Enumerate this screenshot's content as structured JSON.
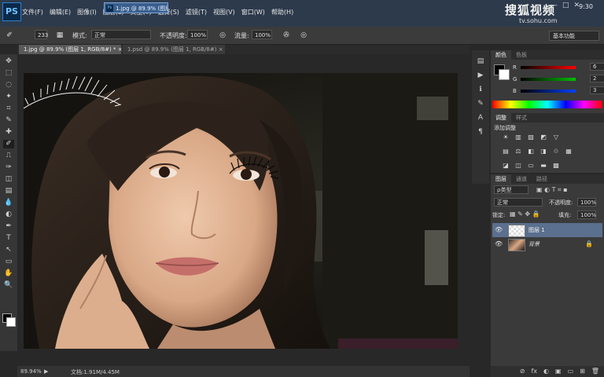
{
  "app": {
    "logo": "PS",
    "taskbar_title": "1.jpg @ 89.9% (图层..."
  },
  "menu": [
    "文件(F)",
    "编辑(E)",
    "图像(I)",
    "图层(L)",
    "类型(Y)",
    "选择(S)",
    "滤镜(T)",
    "视图(V)",
    "窗口(W)",
    "帮助(H)"
  ],
  "window_controls": {
    "minimize": "—",
    "maximize": "□",
    "close": "✕"
  },
  "watermark": {
    "logo": "搜狐视频",
    "url": "tv.sohu.com"
  },
  "clock": "9:30",
  "options": {
    "brush_size": "233",
    "mode_label": "模式:",
    "mode_value": "正常",
    "opacity_label": "不透明度:",
    "opacity_value": "100%",
    "flow_label": "流量:",
    "flow_value": "100%",
    "workspace": "基本功能"
  },
  "tabs": [
    {
      "label": "1.jpg @ 89.9% (图层 1, RGB/8#) * ×",
      "active": true
    },
    {
      "label": "1.psd @ 89.9% (图层 1, RGB/8#) ×",
      "active": false
    }
  ],
  "tools": [
    "move-icon",
    "marquee-icon",
    "lasso-icon",
    "magic-wand-icon",
    "crop-icon",
    "eyedropper-icon",
    "healing-icon",
    "brush-icon",
    "stamp-icon",
    "history-brush-icon",
    "eraser-icon",
    "gradient-icon",
    "blur-icon",
    "dodge-icon",
    "pen-icon",
    "type-icon",
    "path-select-icon",
    "shape-icon",
    "hand-icon",
    "zoom-icon"
  ],
  "tool_glyphs": [
    "✥",
    "⬚",
    "◌",
    "✦",
    "⌗",
    "✎",
    "✚",
    "✐",
    "⎍",
    "✑",
    "◫",
    "▤",
    "💧",
    "◐",
    "✒",
    "T",
    "↖",
    "▭",
    "✋",
    "🔍"
  ],
  "color_panel": {
    "tabs": [
      "颜色",
      "色板"
    ],
    "channels": [
      {
        "name": "R",
        "value": "6",
        "color": "#ff0000"
      },
      {
        "name": "G",
        "value": "2",
        "color": "#00c000"
      },
      {
        "name": "B",
        "value": "3",
        "color": "#0040ff"
      }
    ]
  },
  "adjust_panel": {
    "tabs": [
      "调整",
      "样式"
    ],
    "title": "添加调整",
    "rows": [
      [
        "☀",
        "▥",
        "▨",
        "◩",
        "▽"
      ],
      [
        "▤",
        "⚖",
        "◧",
        "◨",
        "♲",
        "▦"
      ],
      [
        "◪",
        "◫",
        "▭",
        "▬",
        "▩"
      ]
    ]
  },
  "layers_panel": {
    "tabs": [
      "图层",
      "通道",
      "路径"
    ],
    "kind": "ρ类型",
    "blend": "正常",
    "opacity_label": "不透明度:",
    "opacity": "100%",
    "lock_label": "锁定:",
    "fill_label": "填充:",
    "fill": "100%",
    "layers": [
      {
        "name": "图层 1",
        "selected": true
      },
      {
        "name": "背景",
        "selected": false,
        "locked": true
      }
    ],
    "bottom_icons": [
      "⊘",
      "fx",
      "◐",
      "▣",
      "▭",
      "⊞",
      "🗑"
    ]
  },
  "status": {
    "zoom": "89.94%",
    "doc": "文档:1.91M/4.45M"
  }
}
